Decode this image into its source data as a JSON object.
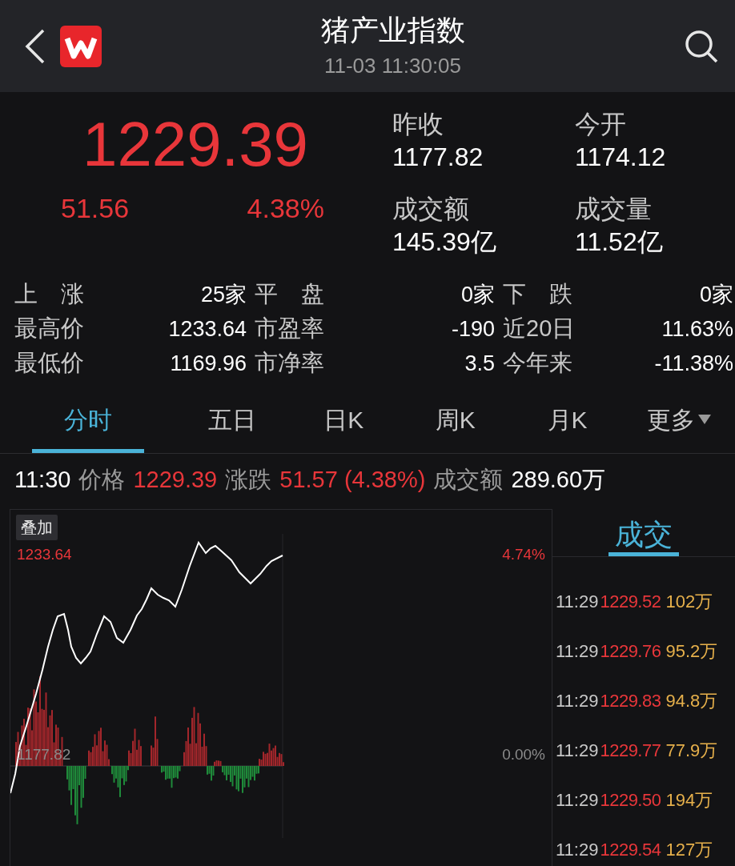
{
  "header": {
    "title": "猪产业指数",
    "time": "11-03 11:30:05"
  },
  "quote": {
    "price": "1229.39",
    "change": "51.56",
    "change_pct": "4.38%"
  },
  "summary": [
    {
      "label": "昨收",
      "value": "1177.82"
    },
    {
      "label": "今开",
      "value": "1174.12"
    },
    {
      "label": "成交额",
      "value": "145.39亿"
    },
    {
      "label": "成交量",
      "value": "11.52亿"
    }
  ],
  "stats": [
    [
      {
        "label": "上　涨",
        "value": "25家"
      },
      {
        "label": "平　盘",
        "value": "0家"
      },
      {
        "label": "下　跌",
        "value": "0家"
      }
    ],
    [
      {
        "label": "最高价",
        "value": "1233.64"
      },
      {
        "label": "市盈率",
        "value": "-190"
      },
      {
        "label": "近20日",
        "value": "11.63%"
      }
    ],
    [
      {
        "label": "最低价",
        "value": "1169.96"
      },
      {
        "label": "市净率",
        "value": "3.5"
      },
      {
        "label": "今年来",
        "value": "-11.38%"
      }
    ]
  ],
  "tabs": [
    {
      "label": "分时",
      "selected": true,
      "kind": "tab"
    },
    {
      "label": "五日",
      "selected": false,
      "kind": "tab"
    },
    {
      "label": "日K",
      "selected": false,
      "kind": "tab"
    },
    {
      "label": "周K",
      "selected": false,
      "kind": "tab"
    },
    {
      "label": "月K",
      "selected": false,
      "kind": "tab"
    },
    {
      "label": "更多",
      "selected": false,
      "kind": "dropdown"
    }
  ],
  "info_bar": {
    "time": "11:30",
    "price_label": "价格",
    "price": "1229.39",
    "change_label": "涨跌",
    "change": "51.57 (4.38%)",
    "amount_label": "成交额",
    "amount": "289.60万"
  },
  "chart": {
    "overlay_button": "叠加",
    "high_label": "1233.64",
    "high_pct": "4.74%",
    "base_label": "1177.82",
    "base_pct": "0.00%"
  },
  "trades": {
    "title": "成交",
    "rows": [
      {
        "time": "11:29",
        "price": "1229.52",
        "volume": "102万"
      },
      {
        "time": "11:29",
        "price": "1229.76",
        "volume": "95.2万"
      },
      {
        "time": "11:29",
        "price": "1229.83",
        "volume": "94.8万"
      },
      {
        "time": "11:29",
        "price": "1229.77",
        "volume": "77.9万"
      },
      {
        "time": "11:29",
        "price": "1229.50",
        "volume": "194万"
      },
      {
        "time": "11:29",
        "price": "1229.54",
        "volume": "127万"
      }
    ]
  }
}
